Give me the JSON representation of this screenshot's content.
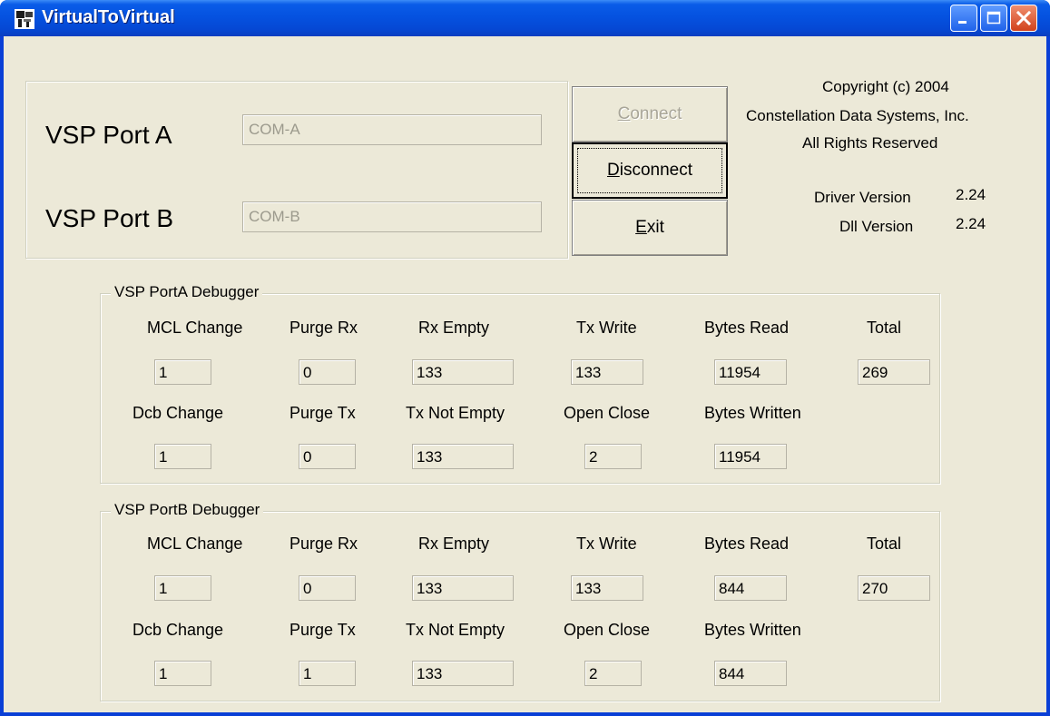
{
  "window": {
    "title": "VirtualToVirtual"
  },
  "ports": {
    "a_label": "VSP Port A",
    "a_value": "COM-A",
    "b_label": "VSP Port B",
    "b_value": "COM-B"
  },
  "buttons": {
    "connect_prefix": "",
    "connect_mnemonic": "C",
    "connect_rest": "onnect",
    "disconnect_prefix": "",
    "disconnect_mnemonic": "D",
    "disconnect_rest": "isconnect",
    "exit_prefix": "",
    "exit_mnemonic": "E",
    "exit_rest": "xit"
  },
  "info": {
    "copyright_line1": "Copyright (c) 2004",
    "copyright_line2": "Constellation Data Systems, Inc.",
    "copyright_line3": "All Rights Reserved",
    "driver_label": "Driver Version",
    "driver_value": "2.24",
    "dll_label": "Dll Version",
    "dll_value": "2.24"
  },
  "headers": {
    "mcl_change": "MCL Change",
    "purge_rx": "Purge Rx",
    "rx_empty": "Rx Empty",
    "tx_write": "Tx Write",
    "bytes_read": "Bytes Read",
    "total": "Total",
    "dcb_change": "Dcb Change",
    "purge_tx": "Purge Tx",
    "tx_not_empty": "Tx Not Empty",
    "open_close": "Open Close",
    "bytes_written": "Bytes Written"
  },
  "debugA": {
    "title": "VSP PortA Debugger",
    "mcl_change": "1",
    "purge_rx": "0",
    "rx_empty": "133",
    "tx_write": "133",
    "bytes_read": "11954",
    "total": "269",
    "dcb_change": "1",
    "purge_tx": "0",
    "tx_not_empty": "133",
    "open_close": "2",
    "bytes_written": "11954"
  },
  "debugB": {
    "title": "VSP PortB Debugger",
    "mcl_change": "1",
    "purge_rx": "0",
    "rx_empty": "133",
    "tx_write": "133",
    "bytes_read": "844",
    "total": "270",
    "dcb_change": "1",
    "purge_tx": "1",
    "tx_not_empty": "133",
    "open_close": "2",
    "bytes_written": "844"
  },
  "colors": {
    "titlebar": "#0552e0",
    "face": "#ece9d8",
    "close_button": "#d1421c"
  },
  "icons": {
    "app": "virtual-to-virtual-app-icon",
    "minimize": "minimize-icon",
    "maximize": "maximize-icon",
    "close": "close-icon"
  }
}
